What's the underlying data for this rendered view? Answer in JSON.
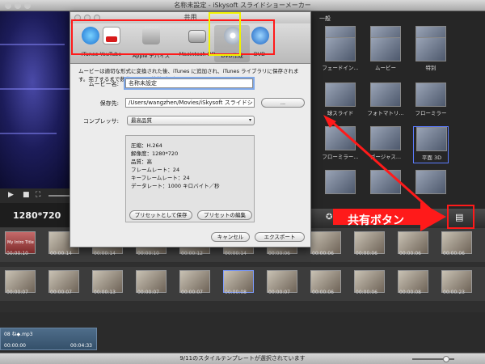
{
  "window": {
    "title": "名称未設定 - iSkysoft スライドショーメーカー"
  },
  "preview": {
    "resolution": "1280*720"
  },
  "style_panel": {
    "header": "一般",
    "tiles": [
      "",
      "",
      "",
      "フェードイン...",
      "ムービー",
      "特別",
      "球スライド",
      "フォトマトリ...",
      "フローミラー",
      "フローミラー...",
      "ゴージャス...",
      "平面 3D",
      "",
      "",
      ""
    ]
  },
  "dialog": {
    "title": "共用",
    "toolbar": [
      {
        "label": "iTunes",
        "icon": "itunes-icon"
      },
      {
        "label": "YouTube",
        "icon": "youtube-icon"
      },
      {
        "label": "Apple デバイス",
        "icon": "apple-device-icon"
      },
      {
        "label": "Macintosh HD",
        "icon": "harddisk-icon"
      },
      {
        "label": "DVD作成",
        "icon": "dvd-disc-icon"
      },
      {
        "label": "DVD",
        "icon": "dvd-icon"
      }
    ],
    "description": "ムービーは適切な形式に変換された後、iTunes に追加され、iTunes ライブラリに保存されます。完了するまで数分かかる可能性があります。",
    "movie_name_label": "ムービー名:",
    "movie_name_value": "名称未設定",
    "save_to_label": "保存先:",
    "save_to_value": "/Users/wangzhen/Movies/iSkysoft スライドシ",
    "browse_label": "...",
    "compressor_label": "コンプレッサ:",
    "compressor_value": "最高品質",
    "info": [
      "圧縮：H.264",
      "解像度：1280*720",
      "品質：高",
      "フレームレート：24",
      "キーフレームレート：24",
      "データレート：1000 キロバイト／秒"
    ],
    "save_preset_label": "プリセットとして保存",
    "edit_preset_label": "プリセットの編集",
    "cancel_label": "キャンセル",
    "export_label": "エクスポート"
  },
  "timeline": {
    "row1_times": [
      "00:00:10",
      "00:00:14",
      "00:00:14",
      "00:00:10",
      "00:00:12",
      "00:00:14",
      "00:00:06",
      "00:00:06",
      "00:00:06",
      "00:00:06",
      "00:00:06"
    ],
    "row2_times": [
      "00:00:07",
      "00:00:07",
      "00:00:13",
      "00:00:07",
      "00:00:07",
      "00:00:08",
      "00:00:07",
      "00:00:06",
      "00:00:06",
      "00:00:08",
      "00:00:23"
    ],
    "title_clip_text": "My Intro Title"
  },
  "audio": {
    "filename": "08 ね◆.mp3",
    "time_start": "00:00:00",
    "time_end": "00:04:33"
  },
  "status": {
    "text": "9/11のスタイルテンプレートが選択されています"
  },
  "annotation": {
    "callout_text": "共有ボタン",
    "color": "#ff1a1a"
  }
}
